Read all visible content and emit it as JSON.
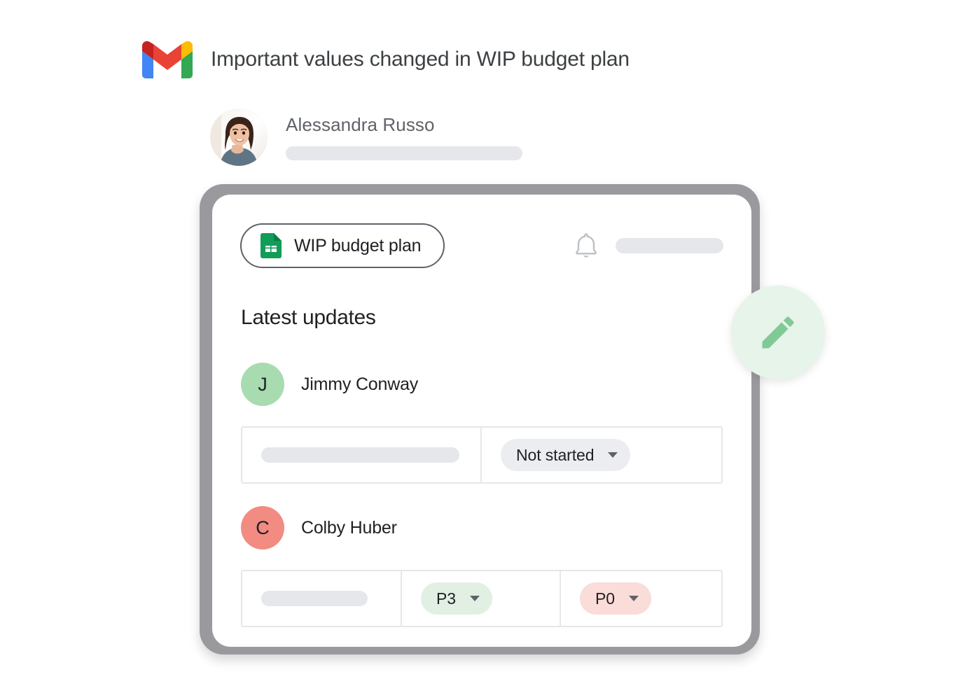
{
  "notification": {
    "app_icon": "gmail-icon",
    "subject": "Important values changed in WIP budget plan"
  },
  "sender": {
    "avatar": "user-photo-avatar",
    "name": "Alessandra Russo",
    "subtext_placeholder": ""
  },
  "card": {
    "doc_chip": {
      "icon": "google-sheets-icon",
      "label": "WIP budget plan"
    },
    "notification_bell": {
      "icon": "bell-icon",
      "placeholder": ""
    },
    "section_title": "Latest updates",
    "updates": [
      {
        "avatar_initial": "J",
        "avatar_color": "#a8dcb0",
        "name": "Jimmy Conway",
        "cells": [
          {
            "type": "placeholder",
            "value": ""
          },
          {
            "type": "chip",
            "value": "Not started",
            "chip_bg": "#ebedf0",
            "has_caret": true
          }
        ]
      },
      {
        "avatar_initial": "C",
        "avatar_color": "#f28b82",
        "name": "Colby Huber",
        "cells": [
          {
            "type": "placeholder",
            "value": ""
          },
          {
            "type": "chip",
            "value": "P3",
            "chip_bg": "#e2f0e4",
            "has_caret": true
          },
          {
            "type": "chip",
            "value": "P0",
            "chip_bg": "#fadcd9",
            "has_caret": true
          }
        ]
      }
    ],
    "fab": {
      "icon": "pencil-edit-icon",
      "bg": "#e6f4ea",
      "fg": "#81c995"
    }
  },
  "colors": {
    "card_border": "#9a9a9e",
    "table_border": "#e6e7ea",
    "placeholder_bar": "#e6e7ea",
    "subject_text": "#3c4043",
    "primary_text": "#202124"
  }
}
